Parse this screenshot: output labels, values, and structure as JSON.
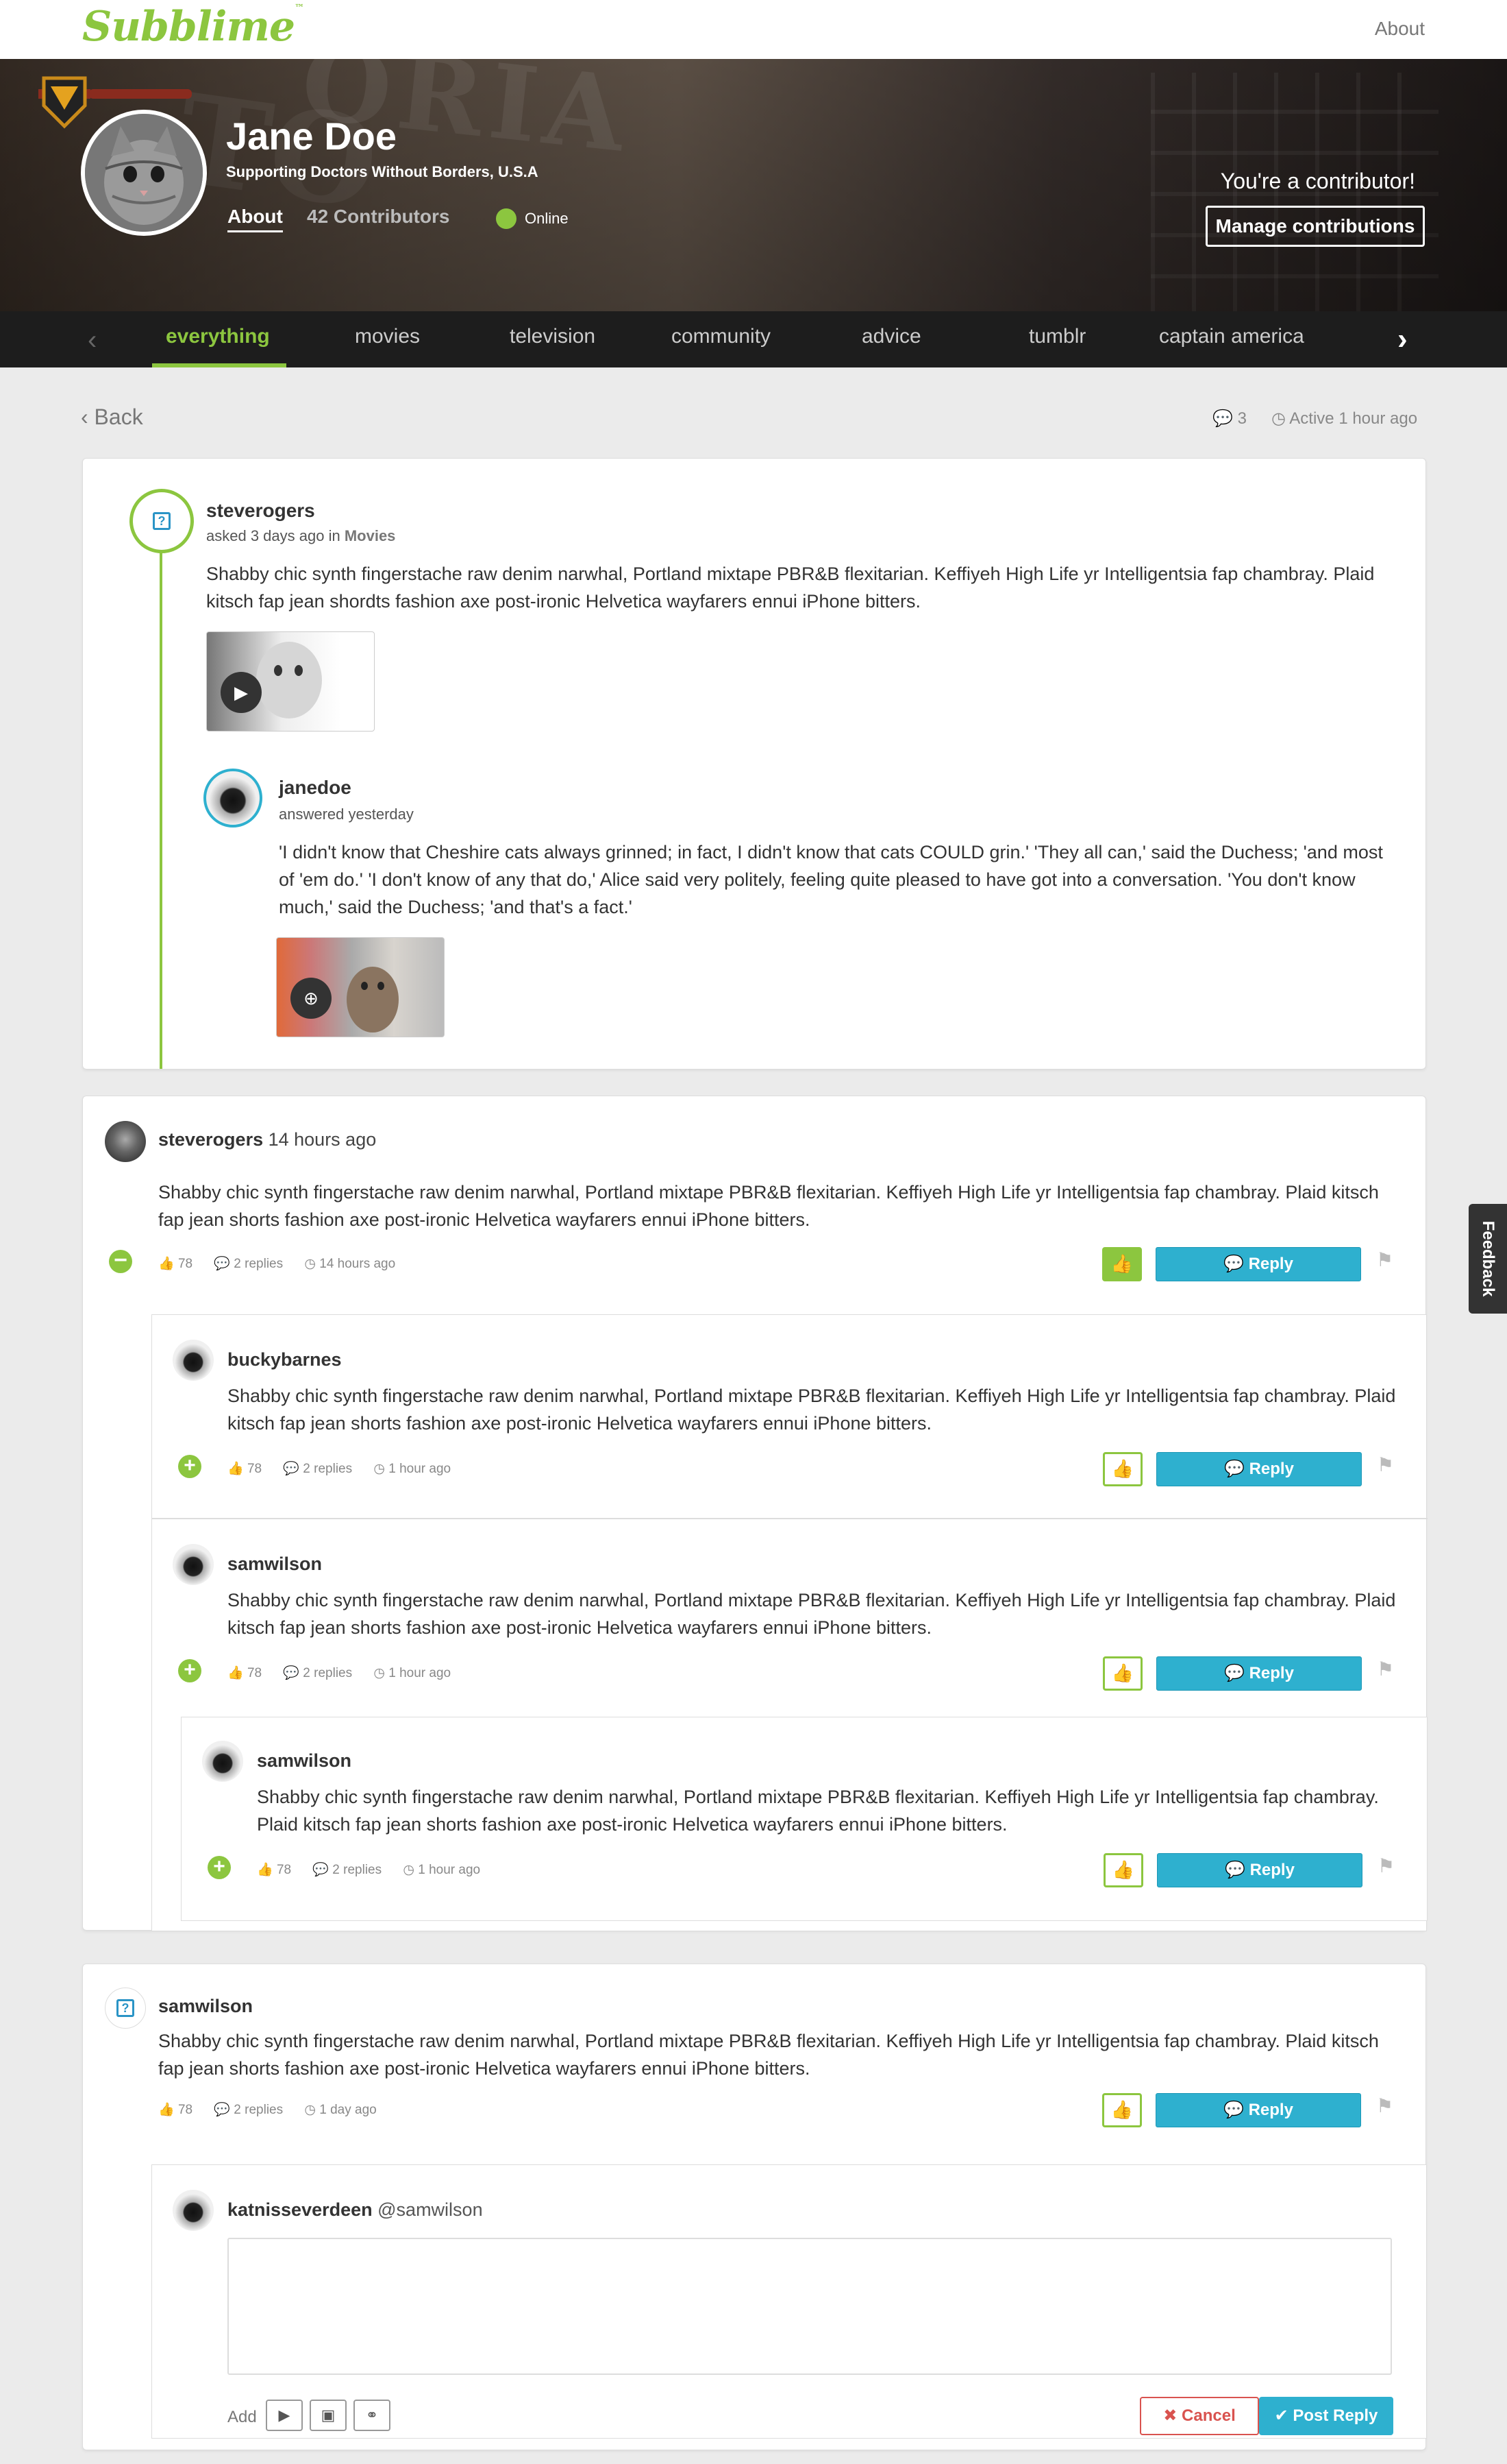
{
  "topbar": {
    "logo": "Subblime",
    "about_link": "About"
  },
  "profile": {
    "name": "Jane Doe",
    "supporting": "Supporting Doctors Without Borders, U.S.A",
    "about_tab": "About",
    "contributors_tab": "42 Contributors",
    "status": "Online",
    "contributor_msg": "You're a contributor!",
    "manage_button": "Manage contributions"
  },
  "tabs": [
    "everything",
    "movies",
    "television",
    "community",
    "advice",
    "tumblr",
    "captain america"
  ],
  "active_tab": "everything",
  "page": {
    "back": "Back",
    "comment_count": "3",
    "active": "Active 1 hour ago"
  },
  "question": {
    "author": "steverogers",
    "meta_prefix": "asked 3 days ago in",
    "category": "Movies",
    "body": "Shabby chic synth fingerstache raw denim narwhal, Portland mixtape PBR&B flexitarian. Keffiyeh High Life yr Intelligentsia fap chambray. Plaid kitsch fap jean shordts fashion axe post-ironic Helvetica wayfarers ennui iPhone bitters.",
    "answer": {
      "author": "janedoe",
      "meta": "answered yesterday",
      "body": "'I didn't know that Cheshire cats always grinned; in fact, I didn't know that cats COULD grin.' 'They all can,' said the Duchess; 'and most of 'em do.' 'I don't know of any that do,' Alice said very politely, feeling quite pleased to have got into a conversation. 'You don't know much,' said the Duchess; 'and that's a fact.'"
    }
  },
  "comments": {
    "c1": {
      "author": "steverogers",
      "time_inline": "14 hours ago",
      "body": "Shabby chic synth fingerstache raw denim narwhal, Portland mixtape PBR&B flexitarian. Keffiyeh High Life yr Intelligentsia fap chambray. Plaid kitsch fap jean shorts fashion axe post-ironic Helvetica wayfarers ennui iPhone bitters.",
      "likes": "78",
      "replies": "2 replies",
      "time": "14 hours ago"
    },
    "r1": {
      "author": "buckybarnes",
      "body": "Shabby chic synth fingerstache raw denim narwhal, Portland mixtape PBR&B flexitarian. Keffiyeh High Life yr Intelligentsia fap chambray. Plaid kitsch fap jean shorts fashion axe post-ironic Helvetica wayfarers ennui iPhone bitters.",
      "likes": "78",
      "replies": "2 replies",
      "time": "1 hour ago"
    },
    "r2": {
      "author": "samwilson",
      "body": "Shabby chic synth fingerstache raw denim narwhal, Portland mixtape PBR&B flexitarian. Keffiyeh High Life yr Intelligentsia fap chambray. Plaid kitsch fap jean shorts fashion axe post-ironic Helvetica wayfarers ennui iPhone bitters.",
      "likes": "78",
      "replies": "2 replies",
      "time": "1 hour ago"
    },
    "r3": {
      "author": "samwilson",
      "body": "Shabby chic synth fingerstache raw denim narwhal, Portland mixtape PBR&B flexitarian. Keffiyeh High Life yr Intelligentsia fap chambray. Plaid kitsch fap jean shorts fashion axe post-ironic Helvetica wayfarers ennui iPhone bitters.",
      "likes": "78",
      "replies": "2 replies",
      "time": "1 hour ago"
    },
    "c2": {
      "author": "samwilson",
      "body": "Shabby chic synth fingerstache raw denim narwhal, Portland mixtape PBR&B flexitarian. Keffiyeh High Life yr Intelligentsia fap chambray. Plaid kitsch fap jean shorts fashion axe post-ironic Helvetica wayfarers ennui iPhone bitters.",
      "likes": "78",
      "replies": "2 replies",
      "time": "1 day ago"
    }
  },
  "actions": {
    "reply": "Reply"
  },
  "reply_form": {
    "author": "katnisseverdeen",
    "mention": "@samwilson",
    "add_label": "Add",
    "cancel": "Cancel",
    "post": "Post Reply"
  },
  "feedback_tab": "Feedback",
  "colors": {
    "brand_green": "#8cc63f",
    "reply_blue": "#2eb0cf",
    "cancel_red": "#d9534f"
  },
  "icons": [
    "badge-icon",
    "play-icon",
    "zoom-icon",
    "comments-icon",
    "clock-icon",
    "thumbs-up-icon",
    "flag-icon",
    "video-icon",
    "image-icon",
    "link-icon",
    "plus-icon",
    "minus-icon",
    "question-icon",
    "chevron-left-icon",
    "chevron-right-icon"
  ]
}
